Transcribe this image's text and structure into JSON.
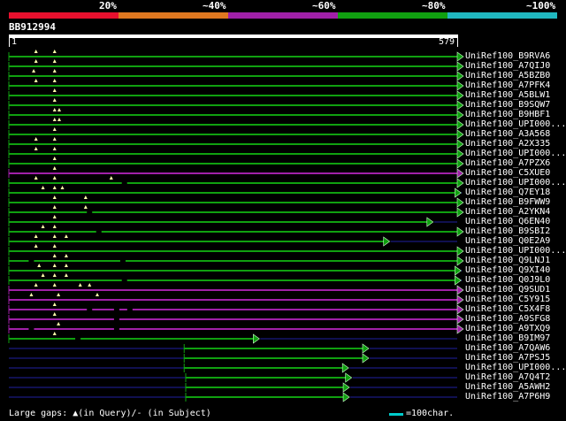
{
  "legend": {
    "labels": [
      "20%",
      "~40%",
      "~60%",
      "~80%",
      "~100%"
    ],
    "colors": [
      "#e8102e",
      "#e07820",
      "#a020a8",
      "#10a010",
      "#20b8c0"
    ]
  },
  "query": {
    "name": "BB912994",
    "start": "1",
    "end": "579",
    "length": 579
  },
  "hits": [
    {
      "id": "UniRef100_B9RVA6",
      "color": "green",
      "start": 1,
      "end": 579,
      "gaps_query": [
        36,
        60
      ],
      "gaps_subject": []
    },
    {
      "id": "UniRef100_A7QIJ0",
      "color": "green",
      "start": 1,
      "end": 579,
      "gaps_query": [
        36,
        60
      ],
      "gaps_subject": []
    },
    {
      "id": "UniRef100_A5BZB0",
      "color": "green",
      "start": 1,
      "end": 579,
      "gaps_query": [
        33,
        60
      ],
      "gaps_subject": []
    },
    {
      "id": "UniRef100_A7PFK4",
      "color": "green",
      "start": 1,
      "end": 579,
      "gaps_query": [
        36,
        60
      ],
      "gaps_subject": []
    },
    {
      "id": "UniRef100_A5BLW1",
      "color": "green",
      "start": 1,
      "end": 579,
      "gaps_query": [
        60
      ],
      "gaps_subject": []
    },
    {
      "id": "UniRef100_B9SQW7",
      "color": "green",
      "start": 1,
      "end": 579,
      "gaps_query": [
        60
      ],
      "gaps_subject": []
    },
    {
      "id": "UniRef100_B9HBF1",
      "color": "green",
      "start": 1,
      "end": 579,
      "gaps_query": [
        60,
        66
      ],
      "gaps_subject": []
    },
    {
      "id": "UniRef100_UPI000...",
      "color": "green",
      "start": 1,
      "end": 579,
      "gaps_query": [
        60,
        66
      ],
      "gaps_subject": []
    },
    {
      "id": "UniRef100_A3A568",
      "color": "green",
      "start": 1,
      "end": 579,
      "gaps_query": [
        60
      ],
      "gaps_subject": []
    },
    {
      "id": "UniRef100_A2X335",
      "color": "green",
      "start": 1,
      "end": 579,
      "gaps_query": [
        36,
        60
      ],
      "gaps_subject": []
    },
    {
      "id": "UniRef100_UPI000...",
      "color": "green",
      "start": 1,
      "end": 579,
      "gaps_query": [
        36,
        60
      ],
      "gaps_subject": []
    },
    {
      "id": "UniRef100_A7PZX6",
      "color": "green",
      "start": 1,
      "end": 579,
      "gaps_query": [
        60
      ],
      "gaps_subject": []
    },
    {
      "id": "UniRef100_C5XUE0",
      "color": "purple",
      "start": 1,
      "end": 579,
      "gaps_query": [
        60
      ],
      "gaps_subject": []
    },
    {
      "id": "UniRef100_UPI000...",
      "color": "green",
      "start": 1,
      "end": 579,
      "gaps_query": [
        36,
        60,
        133
      ],
      "gaps_subject": [
        150
      ]
    },
    {
      "id": "UniRef100_Q7EY18",
      "color": "green",
      "start": 1,
      "end": 576,
      "gaps_query": [
        45,
        60,
        70
      ],
      "gaps_subject": []
    },
    {
      "id": "UniRef100_B9FWW9",
      "color": "green",
      "start": 1,
      "end": 579,
      "gaps_query": [
        60,
        100
      ],
      "gaps_subject": []
    },
    {
      "id": "UniRef100_A2YKN4",
      "color": "green",
      "start": 1,
      "end": 579,
      "gaps_query": [
        60,
        100
      ],
      "gaps_subject": [
        105
      ]
    },
    {
      "id": "UniRef100_Q6EN40",
      "color": "green",
      "start": 1,
      "end": 540,
      "gaps_query": [
        60
      ],
      "gaps_subject": []
    },
    {
      "id": "UniRef100_B9SBI2",
      "color": "green",
      "start": 1,
      "end": 579,
      "gaps_query": [
        45,
        60
      ],
      "gaps_subject": [
        117
      ]
    },
    {
      "id": "UniRef100_Q0E2A9",
      "color": "green",
      "start": 1,
      "end": 484,
      "gaps_query": [
        36,
        60,
        75
      ],
      "gaps_subject": []
    },
    {
      "id": "UniRef100_UPI000...",
      "color": "green",
      "start": 1,
      "end": 579,
      "gaps_query": [
        36,
        60
      ],
      "gaps_subject": []
    },
    {
      "id": "UniRef100_Q9LNJ1",
      "color": "green",
      "start": 1,
      "end": 579,
      "gaps_query": [
        60,
        75
      ],
      "gaps_subject": [
        30,
        148
      ]
    },
    {
      "id": "UniRef100_Q9XI40",
      "color": "green",
      "start": 1,
      "end": 576,
      "gaps_query": [
        40,
        60,
        75
      ],
      "gaps_subject": []
    },
    {
      "id": "UniRef100_Q0J9L0",
      "color": "green",
      "start": 1,
      "end": 576,
      "gaps_query": [
        45,
        60,
        75
      ],
      "gaps_subject": [
        150
      ]
    },
    {
      "id": "UniRef100_Q9SUD1",
      "color": "purple",
      "start": 1,
      "end": 579,
      "gaps_query": [
        36,
        60,
        93,
        105
      ],
      "gaps_subject": []
    },
    {
      "id": "UniRef100_C5Y915",
      "color": "purple",
      "start": 1,
      "end": 579,
      "gaps_query": [
        30,
        65,
        115
      ],
      "gaps_subject": []
    },
    {
      "id": "UniRef100_C5X4F8",
      "color": "purple",
      "start": 1,
      "end": 579,
      "gaps_query": [
        60
      ],
      "gaps_subject": [
        105,
        140,
        157
      ]
    },
    {
      "id": "UniRef100_A9SFG8",
      "color": "purple",
      "start": 1,
      "end": 579,
      "gaps_query": [
        60
      ],
      "gaps_subject": [
        140
      ]
    },
    {
      "id": "UniRef100_A9TXQ9",
      "color": "purple",
      "start": 1,
      "end": 579,
      "gaps_query": [
        65
      ],
      "gaps_subject": [
        30,
        140
      ]
    },
    {
      "id": "UniRef100_B9IM97",
      "color": "green",
      "start": 1,
      "end": 316,
      "gaps_query": [
        60
      ],
      "gaps_subject": [
        90
      ]
    },
    {
      "id": "UniRef100_A7QAW6",
      "color": "green",
      "start": 227,
      "end": 457,
      "gaps_query": [],
      "gaps_subject": []
    },
    {
      "id": "UniRef100_A7PSJ5",
      "color": "green",
      "start": 227,
      "end": 457,
      "gaps_query": [],
      "gaps_subject": []
    },
    {
      "id": "UniRef100_UPI000...",
      "color": "green",
      "start": 227,
      "end": 431,
      "gaps_query": [],
      "gaps_subject": []
    },
    {
      "id": "UniRef100_A7Q4T2",
      "color": "green",
      "start": 229,
      "end": 435,
      "gaps_query": [],
      "gaps_subject": []
    },
    {
      "id": "UniRef100_A5AWH2",
      "color": "green",
      "start": 229,
      "end": 432,
      "gaps_query": [],
      "gaps_subject": []
    },
    {
      "id": "UniRef100_A7P6H9",
      "color": "green",
      "start": 229,
      "end": 432,
      "gaps_query": [],
      "gaps_subject": []
    }
  ],
  "hit_colors": {
    "green": "#10a010",
    "purple": "#a020a8",
    "unaligned": "#101050"
  },
  "footer": {
    "gaps_label": "Large gaps: ",
    "gaps_query_label": "(in Query)/- (in Subject)",
    "query_marker": "▲",
    "scale_label": "=100char.",
    "scale_color": "#00cccc"
  }
}
